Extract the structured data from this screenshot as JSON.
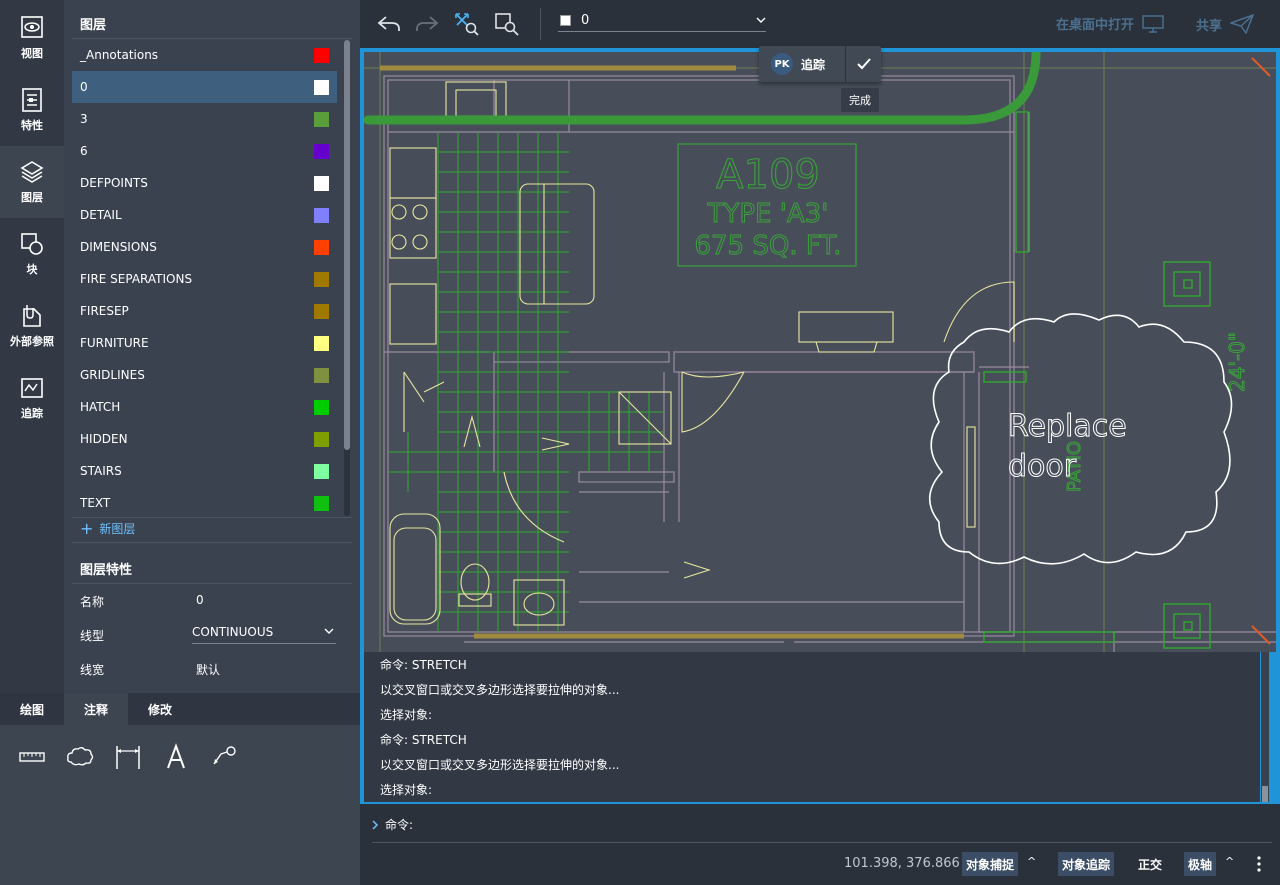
{
  "rail": {
    "items": [
      {
        "label": "视图"
      },
      {
        "label": "特性"
      },
      {
        "label": "图层"
      },
      {
        "label": "块"
      },
      {
        "label": "外部参照"
      },
      {
        "label": "追踪"
      }
    ]
  },
  "layers_panel": {
    "title": "图层",
    "layers": [
      {
        "name": "_Annotations",
        "color": "#ff0000"
      },
      {
        "name": "0",
        "color": "#ffffff"
      },
      {
        "name": "3",
        "color": "#5a9e3b"
      },
      {
        "name": "6",
        "color": "#6600cc"
      },
      {
        "name": "DEFPOINTS",
        "color": "#ffffff"
      },
      {
        "name": "DETAIL",
        "color": "#8080ff"
      },
      {
        "name": "DIMENSIONS",
        "color": "#ff4000"
      },
      {
        "name": "FIRE SEPARATIONS",
        "color": "#a07a00"
      },
      {
        "name": "FIRESEP",
        "color": "#a07a00"
      },
      {
        "name": "FURNITURE",
        "color": "#ffff80"
      },
      {
        "name": "GRIDLINES",
        "color": "#7f9040"
      },
      {
        "name": "HATCH",
        "color": "#00cc00"
      },
      {
        "name": "HIDDEN",
        "color": "#7f9f00"
      },
      {
        "name": "STAIRS",
        "color": "#80ffa0"
      },
      {
        "name": "TEXT",
        "color": "#10c010"
      }
    ],
    "selected_layer": "0",
    "new_layer_label": "新图层"
  },
  "layer_props": {
    "title": "图层特性",
    "name_label": "名称",
    "name_value": "0",
    "linetype_label": "线型",
    "linetype_value": "CONTINUOUS",
    "lineweight_label": "线宽",
    "lineweight_value": "默认"
  },
  "tool_tabs": {
    "tabs": [
      {
        "label": "绘图"
      },
      {
        "label": "注释"
      },
      {
        "label": "修改"
      }
    ],
    "active": "注释"
  },
  "toolbar": {
    "current_layer": "0",
    "open_desktop_label": "在桌面中打开",
    "share_label": "共享"
  },
  "tracking": {
    "avatar_initials": "PK",
    "label": "追踪",
    "done_tooltip": "完成"
  },
  "drawing": {
    "room_name": "A109",
    "room_type": "TYPE 'A3'",
    "room_area": "675 SQ. FT.",
    "cloud_note_line1": "Replace",
    "cloud_note_line2": "door",
    "dimension_text": "24'-0\"",
    "patio_text": "PATIO"
  },
  "command_history": [
    "命令: STRETCH",
    "以交叉窗口或交叉多边形选择要拉伸的对象...",
    "选择对象:",
    "命令: STRETCH",
    "以交叉窗口或交叉多边形选择要拉伸的对象...",
    "选择对象:"
  ],
  "command_prompt": "命令:",
  "statusbar": {
    "coords": "101.398, 376.866",
    "osnap": "对象捕捉",
    "otrack": "对象追踪",
    "ortho": "正交",
    "polar": "极轴"
  }
}
